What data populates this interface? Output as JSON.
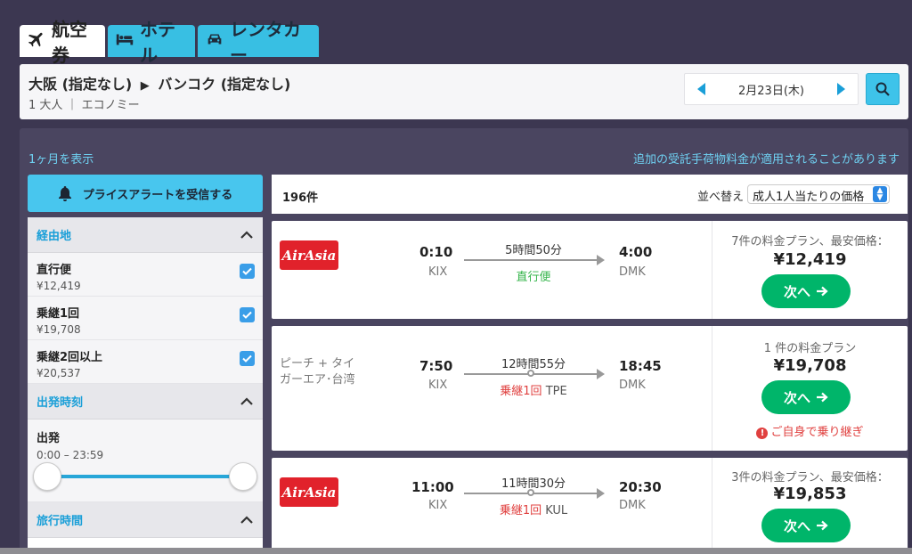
{
  "tabs": [
    {
      "label": "航空券",
      "icon": "plane-icon",
      "active": true
    },
    {
      "label": "ホテル",
      "icon": "bed-icon"
    },
    {
      "label": "レンタカー",
      "icon": "car-icon"
    }
  ],
  "search": {
    "origin": "大阪 (指定なし)",
    "arrow": "▶",
    "destination": "バンコク (指定なし)",
    "passengers": "1 大人 ｜ エコノミー",
    "date": "2月23日(木)"
  },
  "panel": {
    "month_link": "1ヶ月を表示",
    "baggage_note": "追加の受託手荷物料金が適用されることがあります",
    "price_alert": "プライスアラートを受信する"
  },
  "filters": {
    "stops_header": "経由地",
    "stops": [
      {
        "label": "直行便",
        "price": "¥12,419",
        "checked": true
      },
      {
        "label": "乗継1回",
        "price": "¥19,708",
        "checked": true
      },
      {
        "label": "乗継2回以上",
        "price": "¥20,537",
        "checked": true
      }
    ],
    "departure_header": "出発時刻",
    "departure_label": "出発",
    "departure_range": "0:00 – 23:59",
    "duration_header": "旅行時間"
  },
  "results": {
    "count": "196件",
    "sort_label": "並べ替え",
    "sort_value": "成人1人当たりの価格",
    "next_label": "次へ",
    "items": [
      {
        "airline": "AirAsia",
        "dep_time": "0:10",
        "dep_code": "KIX",
        "duration": "5時間50分",
        "stops": "直行便",
        "stop_airport": "",
        "arr_time": "4:00",
        "arr_code": "DMK",
        "plans": "7件の料金プラン、最安価格：",
        "price": "¥12,419"
      },
      {
        "airline": "ピーチ + タイ\nガーエア･台湾",
        "dep_time": "7:50",
        "dep_code": "KIX",
        "duration": "12時間55分",
        "stops": "乗継1回",
        "stop_airport": "TPE",
        "arr_time": "18:45",
        "arr_code": "DMK",
        "plans": "1 件の料金プラン",
        "price": "¥19,708",
        "warning": "ご自身で乗り継ぎ"
      },
      {
        "airline": "AirAsia",
        "dep_time": "11:00",
        "dep_code": "KIX",
        "duration": "11時間30分",
        "stops": "乗継1回",
        "stop_airport": "KUL",
        "arr_time": "20:30",
        "arr_code": "DMK",
        "plans": "3件の料金プラン、最安価格：",
        "price": "¥19,853"
      }
    ]
  },
  "colors": {
    "accent": "#38bfe3",
    "button_green": "#00b56a",
    "airasia_red": "#e1222b",
    "stop_red": "#e0403f",
    "direct_green": "#34b44a"
  }
}
